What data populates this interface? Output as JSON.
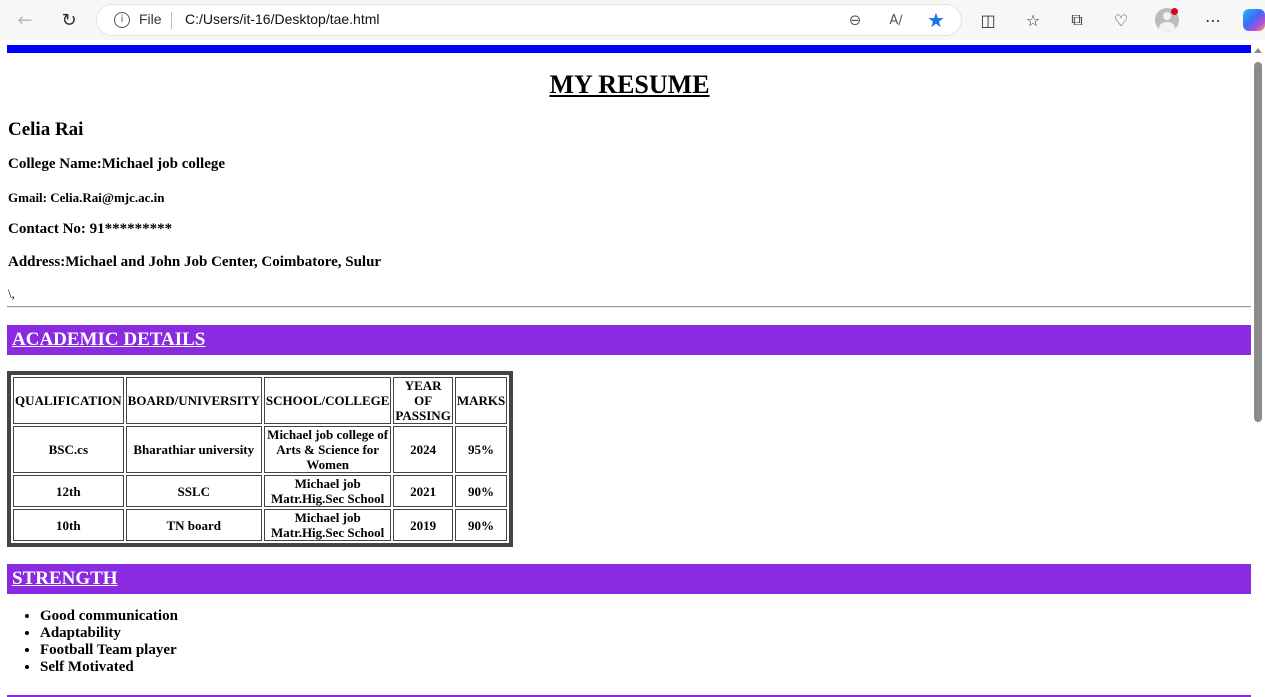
{
  "browser": {
    "file_label": "File",
    "url": "C:/Users/it-16/Desktop/tae.html",
    "icons": [
      "back-icon",
      "refresh-icon",
      "info-icon",
      "zoom-out-icon",
      "read-aloud-icon",
      "favorite-star-icon",
      "split-screen-icon",
      "favorites-icon",
      "collections-icon",
      "browser-essentials-icon",
      "profile-icon",
      "more-icon",
      "copilot-icon"
    ],
    "accent": "#1a73e8"
  },
  "resume": {
    "title": "MY RESUME",
    "name": "Celia Rai",
    "college": "College Name:Michael job college",
    "gmail": "Gmail: Celia.Rai@mjc.ac.in",
    "contact": "Contact No: 91*********",
    "address": "Address:Michael and John Job Center, Coimbatore, Sulur",
    "stray_text": "\\,",
    "colors": {
      "top_bar": "#0000ff",
      "section_bg": "#8a2be2"
    }
  },
  "academic": {
    "heading": "ACADEMIC DETAILS",
    "headers": [
      "QUALIFICATION",
      "BOARD/UNIVERSITY",
      "SCHOOL/COLLEGE",
      "YEAR OF PASSING",
      "MARKS"
    ],
    "rows": [
      [
        "BSC.cs",
        "Bharathiar university",
        "Michael job college of Arts & Science for Women",
        "2024",
        "95%"
      ],
      [
        "12th",
        "SSLC",
        "Michael job Matr.Hig.Sec School",
        "2021",
        "90%"
      ],
      [
        "10th",
        "TN board",
        "Michael job Matr.Hig.Sec School",
        "2019",
        "90%"
      ]
    ]
  },
  "strength": {
    "heading": "STRENGTH",
    "items": [
      "Good communication",
      "Adaptability",
      "Football Team player",
      "Self Motivated"
    ]
  }
}
